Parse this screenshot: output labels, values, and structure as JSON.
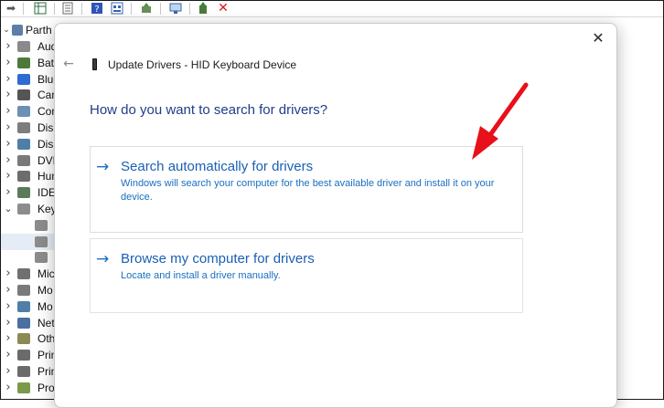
{
  "tree": {
    "root_label": "Parth",
    "items": [
      {
        "label": "Audi",
        "icon": "speaker-icon",
        "expanded": false
      },
      {
        "label": "Batt",
        "icon": "battery-icon",
        "expanded": false
      },
      {
        "label": "Blue",
        "icon": "bluetooth-icon",
        "expanded": false
      },
      {
        "label": "Cam",
        "icon": "camera-icon",
        "expanded": false
      },
      {
        "label": "Com",
        "icon": "computer-icon",
        "expanded": false
      },
      {
        "label": "Disk",
        "icon": "disk-drive-icon",
        "expanded": false
      },
      {
        "label": "Disp",
        "icon": "display-adapter-icon",
        "expanded": false
      },
      {
        "label": "DVD",
        "icon": "dvd-drive-icon",
        "expanded": false
      },
      {
        "label": "Hum",
        "icon": "hid-icon",
        "expanded": false
      },
      {
        "label": "IDE",
        "icon": "ide-controller-icon",
        "expanded": false
      },
      {
        "label": "Key",
        "icon": "keyboard-icon",
        "expanded": true
      },
      {
        "label": "",
        "icon": "keyboard-device-icon",
        "child": true
      },
      {
        "label": "",
        "icon": "keyboard-device-icon",
        "child": true,
        "selected": true
      },
      {
        "label": "",
        "icon": "keyboard-device-icon",
        "child": true
      },
      {
        "label": "Mic",
        "icon": "microphone-icon",
        "expanded": false
      },
      {
        "label": "Mo",
        "icon": "mouse-icon",
        "expanded": false
      },
      {
        "label": "Mo",
        "icon": "monitor-icon",
        "expanded": false
      },
      {
        "label": "Net",
        "icon": "network-adapter-icon",
        "expanded": false
      },
      {
        "label": "Oth",
        "icon": "other-devices-icon",
        "expanded": false
      },
      {
        "label": "Prin",
        "icon": "print-queue-icon",
        "expanded": false
      },
      {
        "label": "Prin",
        "icon": "printer-icon",
        "expanded": false
      },
      {
        "label": "Pro",
        "icon": "processor-icon",
        "expanded": false
      }
    ]
  },
  "dialog": {
    "title": "Update Drivers - HID Keyboard Device",
    "question": "How do you want to search for drivers?",
    "options": [
      {
        "title": "Search automatically for drivers",
        "description": "Windows will search your computer for the best available driver and install it on your device."
      },
      {
        "title": "Browse my computer for drivers",
        "description": "Locate and install a driver manually."
      }
    ]
  },
  "colors": {
    "accent": "#1a5fb4",
    "question": "#1f3d8a",
    "annotation_arrow": "#e8101a"
  }
}
